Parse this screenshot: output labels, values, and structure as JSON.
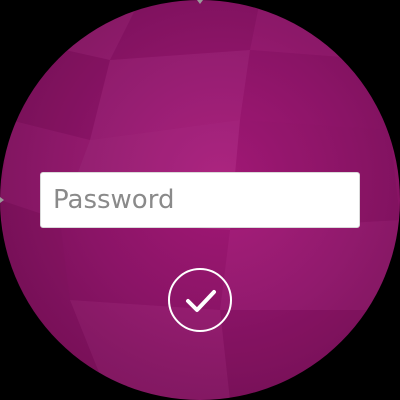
{
  "screen": {
    "background_color": "#000000",
    "accent_color": "#9b1673"
  },
  "login": {
    "password_placeholder": "Password",
    "password_value": "",
    "confirm_icon": "checkmark-icon"
  }
}
